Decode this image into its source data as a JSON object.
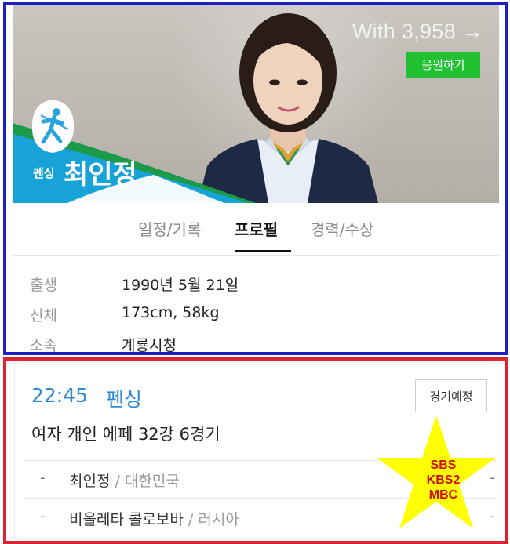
{
  "hero": {
    "cheer_count": "With 3,958 →",
    "cheer_button": "응원하기",
    "sport": "펜싱",
    "name": "최인정"
  },
  "tabs": [
    {
      "label": "일정/기록",
      "active": false
    },
    {
      "label": "프로필",
      "active": true
    },
    {
      "label": "경력/수상",
      "active": false
    }
  ],
  "profile": [
    {
      "label": "출생",
      "value": "1990년 5월 21일"
    },
    {
      "label": "신체",
      "value": "173cm, 58kg"
    },
    {
      "label": "소속",
      "value": "계룡시청"
    }
  ],
  "match": {
    "time": "22:45",
    "sport": "펜싱",
    "status": "경기예정",
    "title": "여자 개인 에페 32강 6경기",
    "competitors": [
      {
        "dash": "-",
        "name": "최인정",
        "country": " / 대한민국",
        "end": "-"
      },
      {
        "dash": "-",
        "name": "비올레타 콜로보바",
        "country": " / 러시아",
        "end": "-"
      }
    ]
  },
  "broadcast": {
    "lines": [
      "SBS",
      "KBS2",
      "MBC"
    ]
  },
  "colors": {
    "top_frame": "#1d1fc4",
    "bottom_frame": "#dc2430",
    "cheer_green": "#20c232",
    "time_blue": "#2e8ad6",
    "star_yellow": "#ffff00",
    "broadcast_red": "#cc1010"
  }
}
